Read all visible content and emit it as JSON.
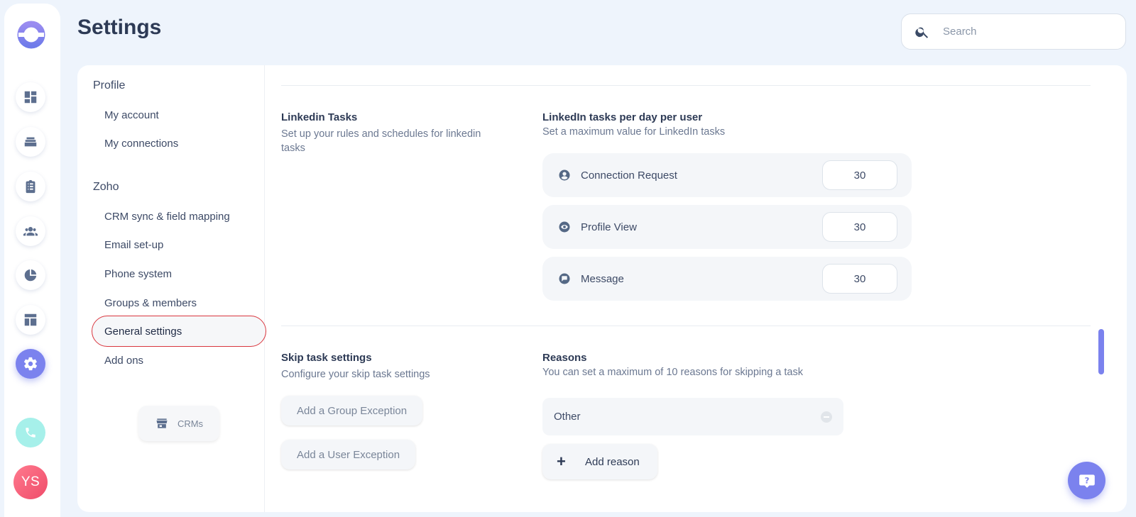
{
  "header": {
    "title": "Settings",
    "search_placeholder": "Search"
  },
  "rail": {
    "icons": [
      "dashboard-icon",
      "layers-icon",
      "clipboard-icon",
      "users-icon",
      "pie-chart-icon",
      "layout-icon",
      "gear-icon"
    ],
    "active": "gear-icon",
    "avatar_initials": "YS"
  },
  "nav": {
    "groups": [
      {
        "label": "Profile",
        "items": [
          "My account",
          "My connections"
        ]
      },
      {
        "label": "Zoho",
        "items": [
          "CRM sync & field mapping",
          "Email set-up",
          "Phone system",
          "Groups & members",
          "General settings",
          "Add ons"
        ]
      }
    ],
    "selected": "General settings",
    "crms_button": "CRMs"
  },
  "linkedin": {
    "title": "Linkedin Tasks",
    "description": "Set up your rules and schedules for linkedin tasks",
    "limits_title": "LinkedIn tasks per day per user",
    "limits_description": "Set a maximum value for LinkedIn tasks",
    "rows": [
      {
        "label": "Connection Request",
        "value": "30",
        "icon": "person-icon"
      },
      {
        "label": "Profile View",
        "value": "30",
        "icon": "eye-icon"
      },
      {
        "label": "Message",
        "value": "30",
        "icon": "message-icon"
      }
    ]
  },
  "skip": {
    "title": "Skip task settings",
    "description": "Configure your skip task settings",
    "group_exception_button": "Add a Group Exception",
    "user_exception_button": "Add a User Exception",
    "reasons_title": "Reasons",
    "reasons_description": "You can set a maximum of 10 reasons for skipping a task",
    "reasons": [
      "Other"
    ],
    "add_reason_button": "Add reason"
  },
  "colors": {
    "accent": "#7b82ee",
    "selected_outline": "#d9363e",
    "phone": "#a6f0ea",
    "avatar": "#ef4c6a"
  }
}
